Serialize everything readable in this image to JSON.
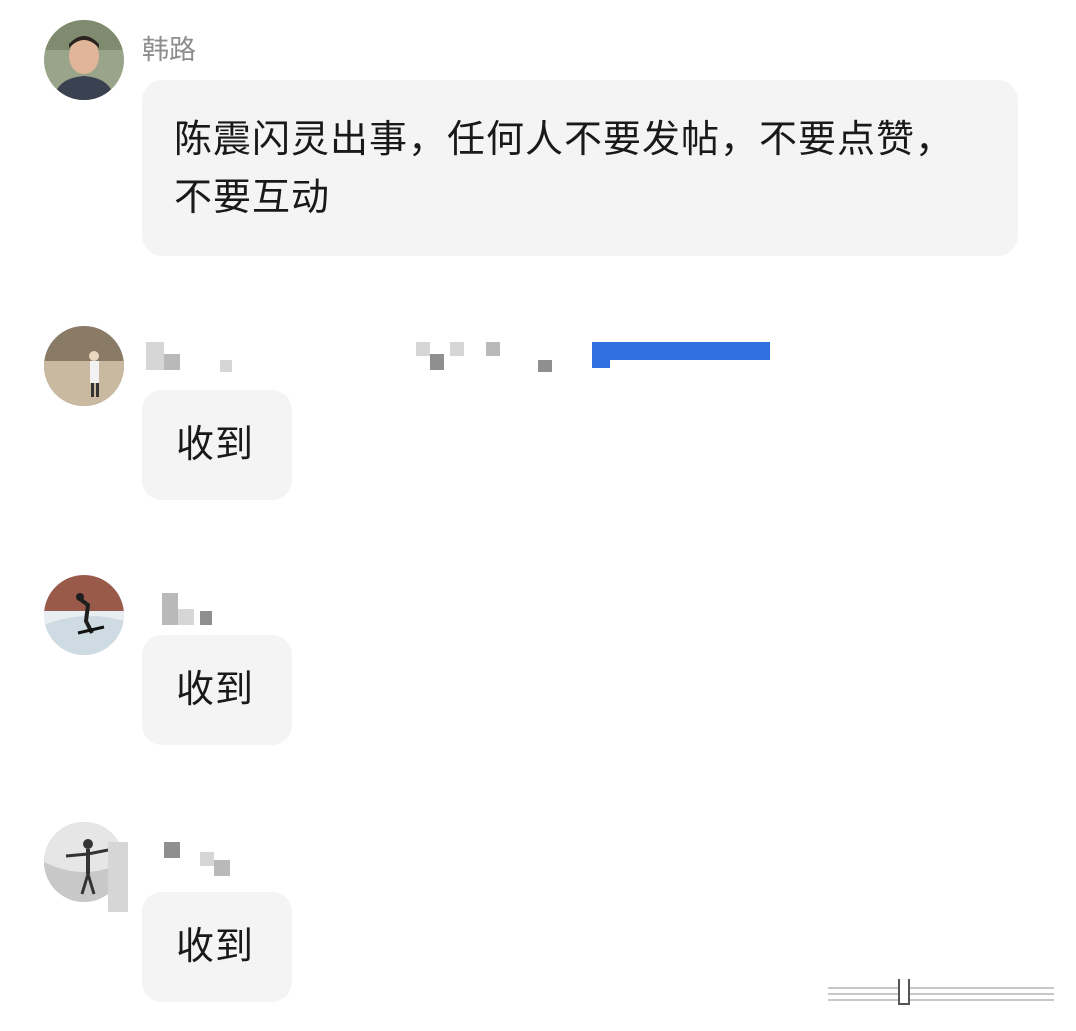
{
  "messages": [
    {
      "sender": "韩路",
      "text": "陈震闪灵出事，任何人不要发帖，不要点赞，不要互动",
      "avatar_icon": "man-portrait-avatar"
    },
    {
      "sender": "",
      "text": "收到",
      "avatar_icon": "outdoor-photo-avatar"
    },
    {
      "sender": "",
      "text": "收到",
      "avatar_icon": "skiing-photo-avatar"
    },
    {
      "sender": "",
      "text": "收到",
      "avatar_icon": "silhouette-photo-avatar"
    }
  ],
  "colors": {
    "bubble_bg": "#f4f4f5",
    "sender_name": "#8e8e8e",
    "message_text": "#191919",
    "redaction_blue": "#2f6fe0"
  }
}
